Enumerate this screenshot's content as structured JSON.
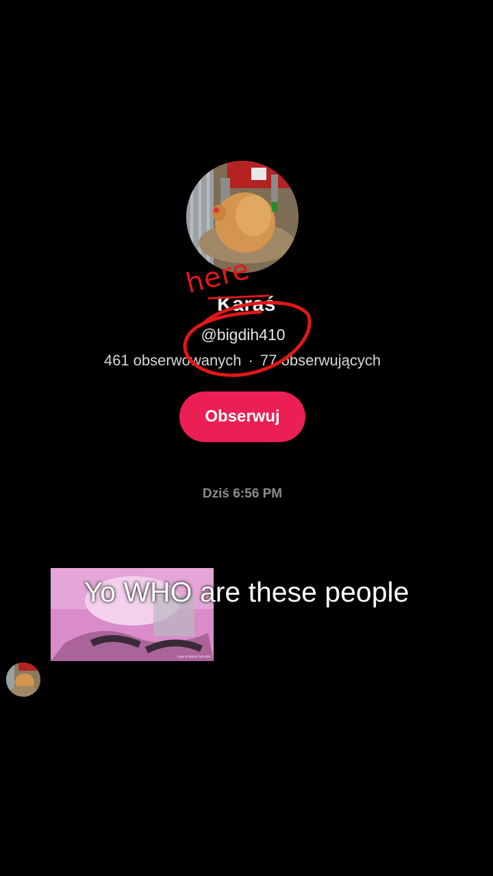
{
  "profile": {
    "display_name": "Karaś",
    "username": "@bigdih410",
    "following_count_label": "461 obserwowanych",
    "separator": "·",
    "followers_count_label": "77 obserwujących",
    "follow_button_label": "Obserwuj",
    "avatar_icon": "chicken-photo"
  },
  "chat": {
    "timestamp": "Dziś 6:56 PM",
    "shared_video": {
      "thumbnail_caption": "yoga & dance tutorials"
    },
    "sender_avatar_icon": "chicken-photo"
  },
  "overlay": {
    "caption": "Yo WHO are these people",
    "annotation_label": "here"
  },
  "colors": {
    "background": "#000000",
    "follow_button": "#ec1f54",
    "annotation": "#e01818"
  }
}
